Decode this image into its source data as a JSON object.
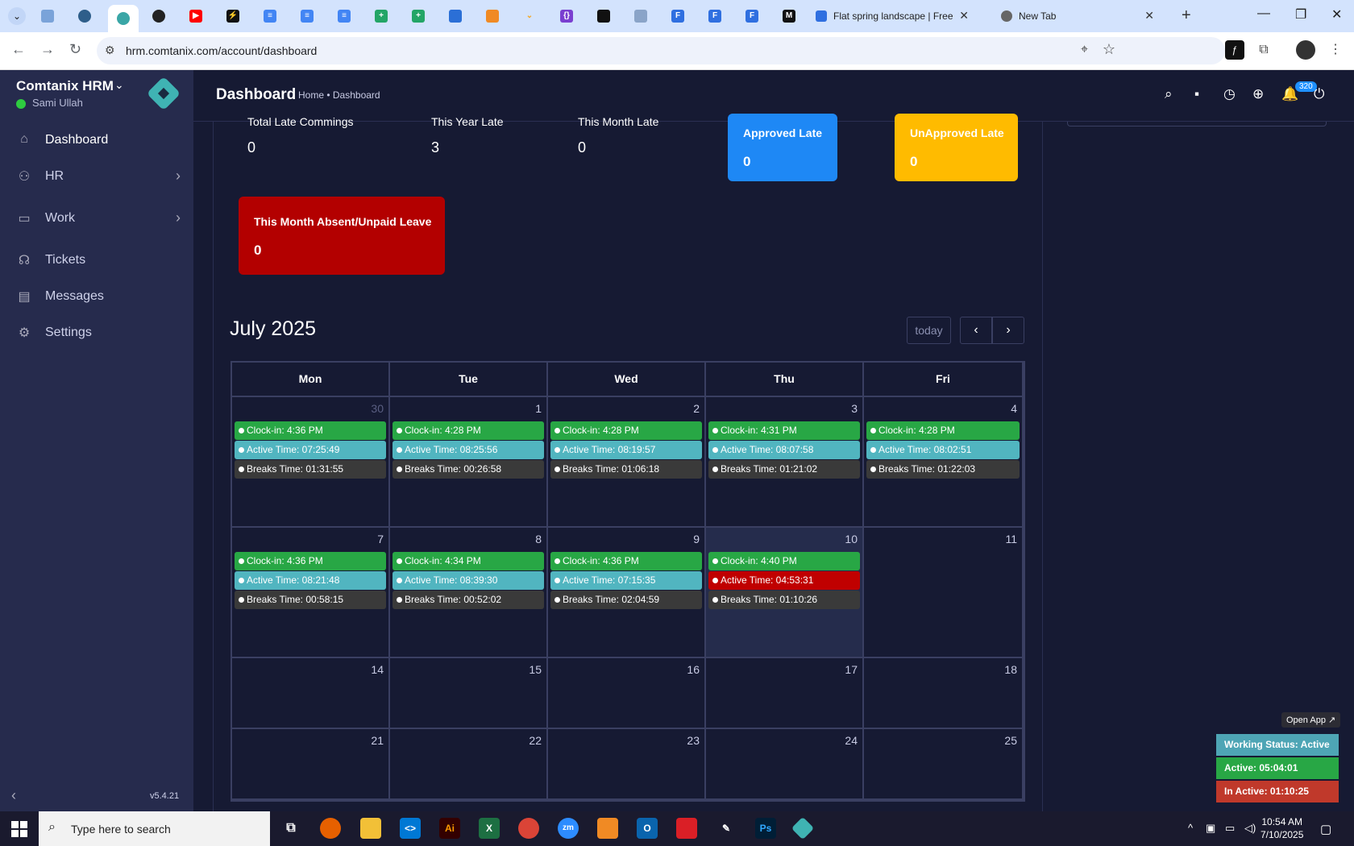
{
  "browser": {
    "tabs": [
      {
        "title": "Flat spring landscape | Free V"
      },
      {
        "title": "New Tab"
      }
    ],
    "url": "hrm.comtanix.com/account/dashboard"
  },
  "app": {
    "brand": "Comtanix HRM",
    "user": "Sami Ullah",
    "version": "v5.4.21",
    "nav": [
      {
        "label": "Dashboard",
        "icon": "home-icon"
      },
      {
        "label": "HR",
        "icon": "users-icon"
      },
      {
        "label": "Work",
        "icon": "briefcase-icon"
      },
      {
        "label": "Tickets",
        "icon": "headset-icon"
      },
      {
        "label": "Messages",
        "icon": "message-icon"
      },
      {
        "label": "Settings",
        "icon": "gear-icon"
      }
    ]
  },
  "header": {
    "title": "Dashboard",
    "breadcrumb": "Home • Dashboard",
    "notification_count": "320"
  },
  "stats": {
    "total_late": {
      "label": "Total Late Commings",
      "value": "0"
    },
    "year_late": {
      "label": "This Year Late",
      "value": "3"
    },
    "month_late": {
      "label": "This Month Late",
      "value": "0"
    },
    "approved_late": {
      "label": "Approved Late",
      "value": "0"
    },
    "unapproved_late": {
      "label": "UnApproved Late",
      "value": "0"
    },
    "absent": {
      "label": "This Month Absent/Unpaid Leave",
      "value": "0"
    }
  },
  "calendar": {
    "title": "July 2025",
    "today_label": "today",
    "days": [
      "Mon",
      "Tue",
      "Wed",
      "Thu",
      "Fri"
    ],
    "weeks": [
      [
        {
          "day": "30",
          "other": true,
          "clock": "Clock-in: 4:36 PM",
          "active": "Active Time: 07:25:49",
          "breaks": "Breaks Time: 01:31:55"
        },
        {
          "day": "1",
          "clock": "Clock-in: 4:28 PM",
          "active": "Active Time: 08:25:56",
          "breaks": "Breaks Time: 00:26:58"
        },
        {
          "day": "2",
          "clock": "Clock-in: 4:28 PM",
          "active": "Active Time: 08:19:57",
          "breaks": "Breaks Time: 01:06:18"
        },
        {
          "day": "3",
          "clock": "Clock-in: 4:31 PM",
          "active": "Active Time: 08:07:58",
          "breaks": "Breaks Time: 01:21:02"
        },
        {
          "day": "4",
          "clock": "Clock-in: 4:28 PM",
          "active": "Active Time: 08:02:51",
          "breaks": "Breaks Time: 01:22:03"
        }
      ],
      [
        {
          "day": "7",
          "clock": "Clock-in: 4:36 PM",
          "active": "Active Time: 08:21:48",
          "breaks": "Breaks Time: 00:58:15"
        },
        {
          "day": "8",
          "clock": "Clock-in: 4:34 PM",
          "active": "Active Time: 08:39:30",
          "breaks": "Breaks Time: 00:52:02"
        },
        {
          "day": "9",
          "clock": "Clock-in: 4:36 PM",
          "active": "Active Time: 07:15:35",
          "breaks": "Breaks Time: 02:04:59"
        },
        {
          "day": "10",
          "today": true,
          "clock": "Clock-in: 4:40 PM",
          "active": "Active Time: 04:53:31",
          "active_alert": true,
          "breaks": "Breaks Time: 01:10:26"
        },
        {
          "day": "11"
        }
      ],
      [
        {
          "day": "14"
        },
        {
          "day": "15"
        },
        {
          "day": "16"
        },
        {
          "day": "17"
        },
        {
          "day": "18"
        }
      ],
      [
        {
          "day": "21"
        },
        {
          "day": "22"
        },
        {
          "day": "23"
        },
        {
          "day": "24"
        },
        {
          "day": "25"
        }
      ]
    ]
  },
  "status_widget": {
    "open_app": "Open App ↗",
    "working": "Working Status: Active",
    "active": "Active: 05:04:01",
    "inactive": "In Active: 01:10:25"
  },
  "taskbar": {
    "search_placeholder": "Type here to search",
    "time": "10:54 AM",
    "date": "7/10/2025"
  },
  "colors": {
    "approved": "#1e88f5",
    "unapproved": "#ffbb00",
    "absent": "#b30000",
    "clockin": "#28a745",
    "active": "#51b5c0",
    "breaks": "#3a3a3a",
    "alert": "#c00000"
  }
}
